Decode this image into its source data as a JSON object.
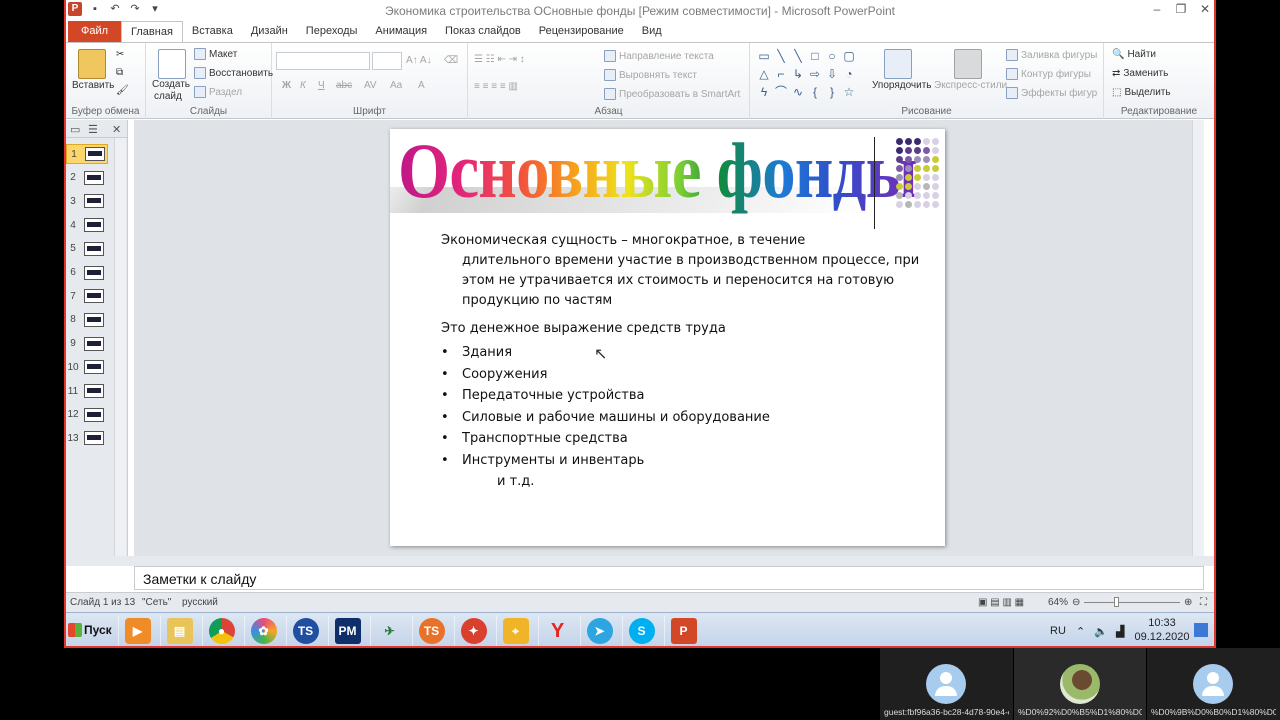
{
  "window": {
    "title": "Экономика строительства ОСновные фонды [Режим совместимости] - Microsoft PowerPoint"
  },
  "tabs": [
    "Файл",
    "Главная",
    "Вставка",
    "Дизайн",
    "Переходы",
    "Анимация",
    "Показ слайдов",
    "Рецензирование",
    "Вид"
  ],
  "active_tab": "Главная",
  "ribbon": {
    "clipboard": {
      "label": "Буфер обмена",
      "paste": "Вставить"
    },
    "slides": {
      "label": "Слайды",
      "new_slide_line1": "Создать",
      "new_slide_line2": "слайд",
      "layout": "Макет",
      "reset": "Восстановить",
      "section": "Раздел"
    },
    "font": {
      "label": "Шрифт"
    },
    "paragraph": {
      "label": "Абзац",
      "text_direction": "Направление текста",
      "align_text": "Выровнять текст",
      "smartart": "Преобразовать в SmartArt"
    },
    "drawing": {
      "label": "Рисование",
      "arrange": "Упорядочить",
      "quick_styles": "Экспресс-стили",
      "shape_fill": "Заливка фигуры",
      "shape_outline": "Контур фигуры",
      "shape_effects": "Эффекты фигур"
    },
    "editing": {
      "label": "Редактирование",
      "find": "Найти",
      "replace": "Заменить",
      "select": "Выделить"
    }
  },
  "thumbnails": [
    "1",
    "2",
    "3",
    "4",
    "5",
    "6",
    "7",
    "8",
    "9",
    "10",
    "11",
    "12",
    "13"
  ],
  "active_slide": "1",
  "slide": {
    "title": "Основные фонды",
    "para1_first": "Экономическая сущность – многократное, в течение",
    "para1_rest": "длительного времени участие в производственном процессе, при этом не утрачивается их стоимость и переносится на готовую продукцию по частям",
    "para2": "Это денежное выражение средств труда",
    "bullets": [
      "Здания",
      "Сооружения",
      "Передаточные устройства",
      "Силовые и рабочие машины и оборудование",
      "Транспортные средства",
      "Инструменты и инвентарь"
    ],
    "etc": "и т.д."
  },
  "notes_placeholder": "Заметки к слайду",
  "status": {
    "slide_counter": "Слайд 1 из 13",
    "theme": "\"Сеть\"",
    "language": "русский",
    "zoom": "64%"
  },
  "taskbar": {
    "start": "Пуск",
    "lang": "RU",
    "time": "10:33",
    "date": "09.12.2020"
  },
  "participants": [
    "guest:fbf96a36-bc28-4d78-90e4-dc...",
    "%D0%92%D0%B5%D1%80%D0%B0...",
    "%D0%9B%D0%B0%D1%80%D0%B8..."
  ],
  "colors": {
    "accent_border": "#e0362e",
    "file_tab": "#d24726",
    "active_thumb": "#fbd76b"
  }
}
